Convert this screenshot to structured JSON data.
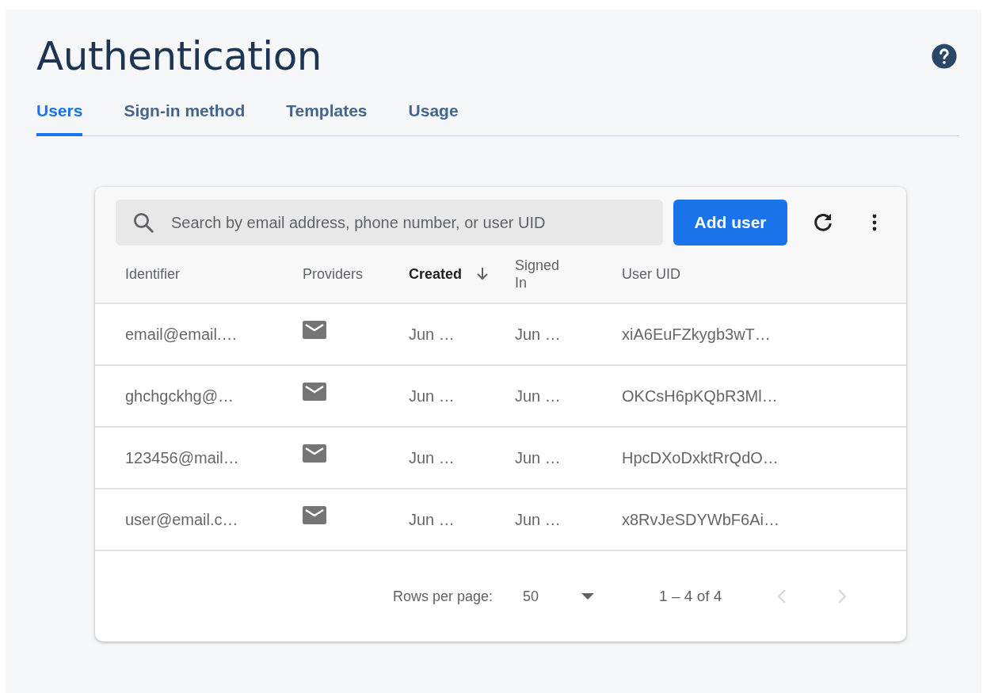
{
  "page": {
    "title": "Authentication"
  },
  "tabs": [
    {
      "label": "Users",
      "selected": true
    },
    {
      "label": "Sign-in method",
      "selected": false
    },
    {
      "label": "Templates",
      "selected": false
    },
    {
      "label": "Usage",
      "selected": false
    }
  ],
  "search": {
    "placeholder": "Search by email address, phone number, or user UID"
  },
  "add_button": "Add user",
  "table": {
    "columns": [
      {
        "label": "Identifier",
        "sorted": false
      },
      {
        "label": "Providers",
        "sorted": false
      },
      {
        "label": "Created",
        "sorted": true
      },
      {
        "label": "Signed In",
        "sorted": false
      },
      {
        "label": "User UID",
        "sorted": false
      }
    ],
    "rows": [
      {
        "identifier": "email@email.…",
        "created": "Jun …",
        "signed_in": "Jun …",
        "uid": "xiA6EuFZkygb3wT…"
      },
      {
        "identifier": "ghchgckhg@…",
        "created": "Jun …",
        "signed_in": "Jun …",
        "uid": "OKCsH6pKQbR3Ml…"
      },
      {
        "identifier": "123456@mail…",
        "created": "Jun …",
        "signed_in": "Jun …",
        "uid": "HpcDXoDxktRrQdO…"
      },
      {
        "identifier": "user@email.c…",
        "created": "Jun …",
        "signed_in": "Jun …",
        "uid": "x8RvJeSDYWbF6Ai…"
      }
    ]
  },
  "pagination": {
    "rows_label": "Rows per page:",
    "rows_value": "50",
    "range": "1 – 4 of 4",
    "prev_disabled": true,
    "next_disabled": true
  }
}
